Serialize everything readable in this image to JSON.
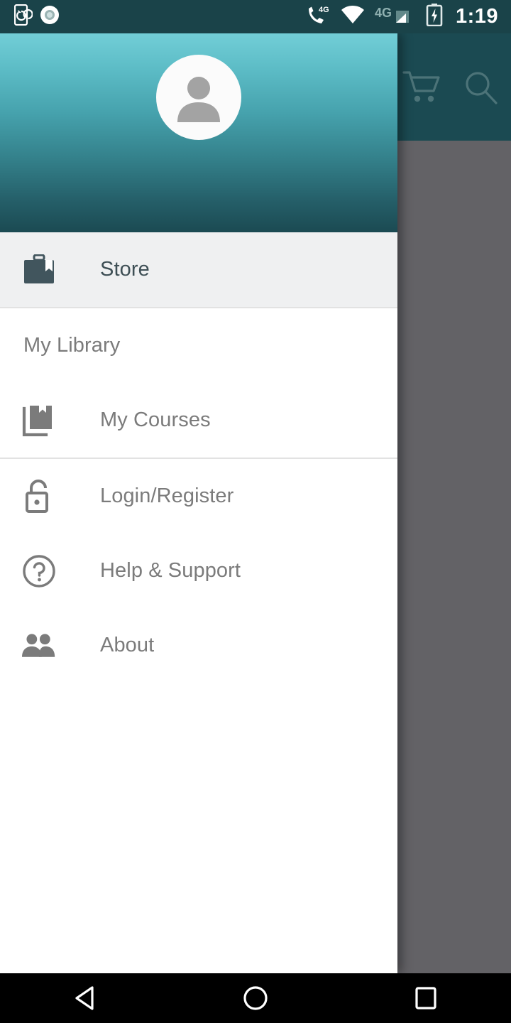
{
  "status_bar": {
    "background": "#1a4349",
    "clock": "1:19",
    "left_icons": [
      {
        "name": "sync-phone-icon",
        "label": "phone sync"
      },
      {
        "name": "record-dot-icon",
        "label": "recording"
      }
    ],
    "right_icons": [
      {
        "name": "volte-4g-call-icon",
        "label": "4G",
        "badge": "4G"
      },
      {
        "name": "wifi-icon",
        "label": "wifi"
      },
      {
        "name": "mobile-network-4g-icon",
        "label": "4G",
        "badge": "4G"
      },
      {
        "name": "signal-bars-icon",
        "label": "signal"
      },
      {
        "name": "battery-charging-icon",
        "label": "charging"
      }
    ]
  },
  "app_bar": {
    "background": "#1b4a52",
    "actions": [
      {
        "name": "cart-icon",
        "label": "Cart"
      },
      {
        "name": "search-icon",
        "label": "Search"
      }
    ]
  },
  "scrim": {
    "color": "#636266"
  },
  "drawer": {
    "header": {
      "gradient_from": "#72ced7",
      "gradient_to": "#1b4a52",
      "avatar": {
        "name": "avatar",
        "background": "#fbfbfb",
        "silhouette_color": "#a3a3a3"
      }
    },
    "selected_background": "#eff0f1",
    "selected_text_color": "#3e4f55",
    "text_color": "#7b7b7b",
    "divider_color": "#e2e2e2",
    "groups": [
      {
        "items": [
          {
            "id": "store",
            "label": "Store",
            "icon": "store-briefcase-icon",
            "selected": true,
            "icon_color": "#41555d"
          }
        ]
      },
      {
        "section_label": "My Library",
        "items": [
          {
            "id": "my-courses",
            "label": "My Courses",
            "icon": "library-books-icon",
            "selected": false,
            "icon_color": "#7b7b7b"
          }
        ]
      },
      {
        "items": [
          {
            "id": "login-register",
            "label": "Login/Register",
            "icon": "unlock-padlock-icon",
            "selected": false,
            "icon_color": "#7b7b7b"
          },
          {
            "id": "help-support",
            "label": "Help & Support",
            "icon": "help-circle-icon",
            "selected": false,
            "icon_color": "#7b7b7b"
          },
          {
            "id": "about",
            "label": "About",
            "icon": "people-group-icon",
            "selected": false,
            "icon_color": "#7b7b7b"
          }
        ]
      }
    ]
  },
  "nav_bar": {
    "background": "#000000",
    "buttons": [
      {
        "name": "back-button",
        "label": "Back"
      },
      {
        "name": "home-button",
        "label": "Home"
      },
      {
        "name": "recents-button",
        "label": "Recents"
      }
    ]
  }
}
